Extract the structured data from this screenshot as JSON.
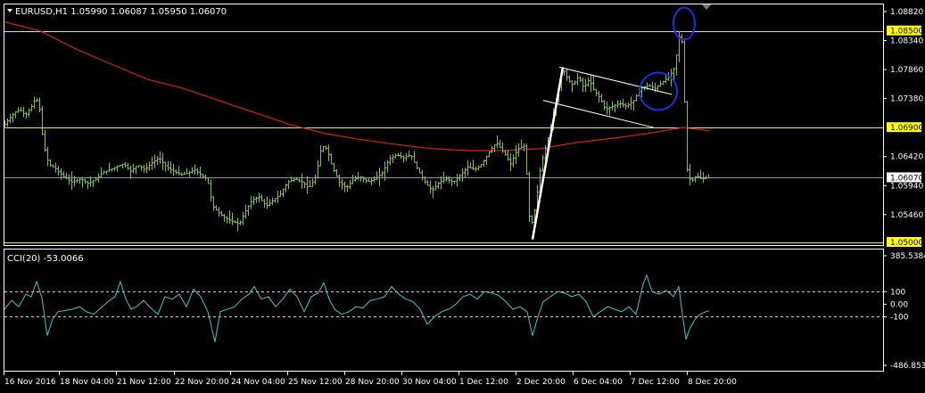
{
  "header": {
    "symbol_line": "EURUSD,H1  1.05990 1.06087 1.05950 1.06070",
    "cci_line": "CCI(20) -53.0066"
  },
  "colors": {
    "background": "#000000",
    "frame": "#ffffff",
    "candles": "#7fc241",
    "moving_average": "#d81b1b",
    "level_lines": "#e8e845",
    "current_price_line": "#8f8fb5",
    "cci_line": "#3cc8c8",
    "annotation_circles": "#1c2ee8",
    "channel_lines": "#ffffff",
    "level_badge_bg": "#ffff00",
    "price_badge_bg": "#ffffff"
  },
  "chart_data": [
    {
      "type": "candlestick",
      "title": "EURUSD,H1",
      "ohlc_current": {
        "open": 1.0599,
        "high": 1.06087,
        "low": 1.0595,
        "close": 1.0607
      },
      "ylim": [
        1.05,
        1.089
      ],
      "y_ticks": [
        "1.08820",
        "1.08340",
        "1.07860",
        "1.07380",
        "1.06420",
        "1.05940",
        "1.05460"
      ],
      "level_lines": [
        {
          "value": 1.085,
          "label": "1.08500"
        },
        {
          "value": 1.069,
          "label": "1.06900"
        },
        {
          "value": 1.05,
          "label": "1.05000"
        }
      ],
      "current_price": {
        "value": 1.0607,
        "label": "1.06070"
      },
      "price_path": [
        [
          0,
          1.069
        ],
        [
          8,
          1.0705
        ],
        [
          14,
          1.0715
        ],
        [
          20,
          1.072
        ],
        [
          26,
          1.071
        ],
        [
          33,
          1.0725
        ],
        [
          38,
          1.074
        ],
        [
          42,
          1.072
        ],
        [
          46,
          1.0665
        ],
        [
          52,
          1.063
        ],
        [
          60,
          1.0622
        ],
        [
          68,
          1.061
        ],
        [
          78,
          1.06
        ],
        [
          88,
          1.0605
        ],
        [
          96,
          1.0598
        ],
        [
          104,
          1.0603
        ],
        [
          112,
          1.0615
        ],
        [
          120,
          1.062
        ],
        [
          128,
          1.0625
        ],
        [
          136,
          1.063
        ],
        [
          144,
          1.0618
        ],
        [
          152,
          1.0628
        ],
        [
          160,
          1.062
        ],
        [
          168,
          1.0632
        ],
        [
          176,
          1.064
        ],
        [
          184,
          1.0625
        ],
        [
          192,
          1.0618
        ],
        [
          200,
          1.0612
        ],
        [
          208,
          1.0615
        ],
        [
          216,
          1.062
        ],
        [
          224,
          1.061
        ],
        [
          230,
          1.0605
        ],
        [
          236,
          1.056
        ],
        [
          242,
          1.055
        ],
        [
          250,
          1.054
        ],
        [
          258,
          1.0535
        ],
        [
          266,
          1.053
        ],
        [
          272,
          1.055
        ],
        [
          280,
          1.057
        ],
        [
          288,
          1.0575
        ],
        [
          296,
          1.056
        ],
        [
          304,
          1.057
        ],
        [
          312,
          1.058
        ],
        [
          320,
          1.06
        ],
        [
          328,
          1.0605
        ],
        [
          336,
          1.06
        ],
        [
          344,
          1.059
        ],
        [
          352,
          1.061
        ],
        [
          358,
          1.066
        ],
        [
          364,
          1.0655
        ],
        [
          370,
          1.0625
        ],
        [
          378,
          1.06
        ],
        [
          386,
          1.059
        ],
        [
          394,
          1.0605
        ],
        [
          402,
          1.0608
        ],
        [
          410,
          1.06
        ],
        [
          418,
          1.0605
        ],
        [
          426,
          1.0615
        ],
        [
          434,
          1.0638
        ],
        [
          442,
          1.0645
        ],
        [
          450,
          1.064
        ],
        [
          458,
          1.0645
        ],
        [
          466,
          1.062
        ],
        [
          474,
          1.06
        ],
        [
          482,
          1.0585
        ],
        [
          490,
          1.06
        ],
        [
          498,
          1.0605
        ],
        [
          506,
          1.06
        ],
        [
          514,
          1.0612
        ],
        [
          522,
          1.0625
        ],
        [
          530,
          1.062
        ],
        [
          538,
          1.063
        ],
        [
          546,
          1.065
        ],
        [
          554,
          1.0665
        ],
        [
          562,
          1.065
        ],
        [
          570,
          1.063
        ],
        [
          578,
          1.0655
        ],
        [
          586,
          1.066
        ],
        [
          592,
          1.052
        ],
        [
          598,
          1.056
        ],
        [
          604,
          1.063
        ],
        [
          610,
          1.066
        ],
        [
          616,
          1.07
        ],
        [
          622,
          1.074
        ],
        [
          628,
          1.079
        ],
        [
          634,
          1.077
        ],
        [
          640,
          1.076
        ],
        [
          646,
          1.0775
        ],
        [
          652,
          1.0755
        ],
        [
          658,
          1.077
        ],
        [
          664,
          1.075
        ],
        [
          670,
          1.074
        ],
        [
          676,
          1.072
        ],
        [
          684,
          1.0725
        ],
        [
          692,
          1.073
        ],
        [
          700,
          1.0725
        ],
        [
          708,
          1.0735
        ],
        [
          716,
          1.0755
        ],
        [
          724,
          1.076
        ],
        [
          732,
          1.0755
        ],
        [
          740,
          1.0765
        ],
        [
          748,
          1.0775
        ],
        [
          754,
          1.079
        ],
        [
          758,
          1.083
        ],
        [
          761,
          1.086
        ],
        [
          764,
          1.0775
        ],
        [
          766,
          1.069
        ],
        [
          768,
          1.062
        ],
        [
          772,
          1.06
        ],
        [
          778,
          1.061
        ],
        [
          784,
          1.0605
        ],
        [
          790,
          1.0607
        ]
      ],
      "moving_average": [
        [
          0,
          1.0865
        ],
        [
          40,
          1.085
        ],
        [
          80,
          1.082
        ],
        [
          120,
          1.0795
        ],
        [
          160,
          1.077
        ],
        [
          200,
          1.0755
        ],
        [
          240,
          1.0735
        ],
        [
          280,
          1.0715
        ],
        [
          320,
          1.0695
        ],
        [
          360,
          1.068
        ],
        [
          400,
          1.067
        ],
        [
          440,
          1.0662
        ],
        [
          480,
          1.0655
        ],
        [
          520,
          1.0652
        ],
        [
          560,
          1.0652
        ],
        [
          600,
          1.0655
        ],
        [
          640,
          1.0665
        ],
        [
          680,
          1.0672
        ],
        [
          720,
          1.068
        ],
        [
          760,
          1.069
        ],
        [
          790,
          1.0685
        ]
      ],
      "x_range": [
        0,
        990
      ]
    },
    {
      "type": "line",
      "title": "CCI(20)",
      "ylim": [
        -486.853,
        385.5384
      ],
      "y_ticks": [
        "385.5384",
        "100",
        "0.00",
        "-100",
        "-486.853"
      ],
      "dashed_levels": [
        100,
        -100
      ],
      "x_labels": [
        "16 Nov 2016",
        "18 Nov 04:00",
        "21 Nov 12:00",
        "22 Nov 20:00",
        "24 Nov 04:00",
        "25 Nov 12:00",
        "28 Nov 20:00",
        "30 Nov 04:00",
        "1 Dec 12:00",
        "2 Dec 20:00",
        "6 Dec 04:00",
        "7 Dec 12:00",
        "8 Dec 20:00"
      ],
      "values": [
        [
          0,
          -40
        ],
        [
          8,
          30
        ],
        [
          16,
          -20
        ],
        [
          24,
          80
        ],
        [
          30,
          60
        ],
        [
          36,
          180
        ],
        [
          42,
          50
        ],
        [
          48,
          -250
        ],
        [
          54,
          -120
        ],
        [
          60,
          -60
        ],
        [
          68,
          -50
        ],
        [
          76,
          -40
        ],
        [
          84,
          -20
        ],
        [
          92,
          -60
        ],
        [
          100,
          -80
        ],
        [
          108,
          -30
        ],
        [
          116,
          20
        ],
        [
          124,
          60
        ],
        [
          130,
          180
        ],
        [
          136,
          40
        ],
        [
          142,
          -40
        ],
        [
          148,
          -20
        ],
        [
          156,
          30
        ],
        [
          164,
          -30
        ],
        [
          172,
          -80
        ],
        [
          180,
          60
        ],
        [
          188,
          40
        ],
        [
          196,
          80
        ],
        [
          204,
          -20
        ],
        [
          212,
          120
        ],
        [
          220,
          60
        ],
        [
          228,
          -60
        ],
        [
          236,
          -300
        ],
        [
          242,
          -60
        ],
        [
          250,
          -40
        ],
        [
          258,
          -20
        ],
        [
          266,
          40
        ],
        [
          274,
          80
        ],
        [
          280,
          140
        ],
        [
          288,
          40
        ],
        [
          296,
          60
        ],
        [
          304,
          -20
        ],
        [
          312,
          40
        ],
        [
          320,
          120
        ],
        [
          328,
          60
        ],
        [
          336,
          -60
        ],
        [
          344,
          60
        ],
        [
          352,
          90
        ],
        [
          358,
          170
        ],
        [
          364,
          40
        ],
        [
          370,
          -40
        ],
        [
          378,
          -80
        ],
        [
          386,
          -60
        ],
        [
          394,
          -20
        ],
        [
          402,
          -30
        ],
        [
          410,
          30
        ],
        [
          418,
          40
        ],
        [
          426,
          60
        ],
        [
          434,
          140
        ],
        [
          442,
          80
        ],
        [
          450,
          40
        ],
        [
          458,
          20
        ],
        [
          466,
          -40
        ],
        [
          474,
          -160
        ],
        [
          482,
          -100
        ],
        [
          490,
          -60
        ],
        [
          498,
          -40
        ],
        [
          506,
          0
        ],
        [
          514,
          60
        ],
        [
          522,
          80
        ],
        [
          530,
          40
        ],
        [
          538,
          100
        ],
        [
          546,
          90
        ],
        [
          554,
          70
        ],
        [
          562,
          20
        ],
        [
          570,
          -40
        ],
        [
          578,
          -20
        ],
        [
          586,
          -60
        ],
        [
          592,
          -250
        ],
        [
          598,
          -100
        ],
        [
          604,
          20
        ],
        [
          612,
          60
        ],
        [
          620,
          100
        ],
        [
          628,
          90
        ],
        [
          636,
          60
        ],
        [
          644,
          80
        ],
        [
          652,
          20
        ],
        [
          660,
          -100
        ],
        [
          668,
          -60
        ],
        [
          676,
          -20
        ],
        [
          684,
          -40
        ],
        [
          692,
          -60
        ],
        [
          700,
          -20
        ],
        [
          708,
          -80
        ],
        [
          716,
          160
        ],
        [
          720,
          230
        ],
        [
          726,
          100
        ],
        [
          734,
          80
        ],
        [
          742,
          110
        ],
        [
          750,
          60
        ],
        [
          756,
          140
        ],
        [
          760,
          -80
        ],
        [
          764,
          -280
        ],
        [
          768,
          -200
        ],
        [
          774,
          -120
        ],
        [
          780,
          -80
        ],
        [
          786,
          -60
        ],
        [
          790,
          -53
        ]
      ]
    }
  ],
  "annotations": {
    "impulse_line": [
      [
        592,
        1.0505
      ],
      [
        626,
        1.079
      ]
    ],
    "channel_top": [
      [
        622,
        1.079
      ],
      [
        748,
        1.0745
      ]
    ],
    "channel_bottom": [
      [
        604,
        1.0735
      ],
      [
        728,
        1.069
      ]
    ],
    "circles": [
      {
        "cx": 733,
        "price": 1.075
      },
      {
        "cx": 762,
        "price": 1.0862
      }
    ]
  }
}
